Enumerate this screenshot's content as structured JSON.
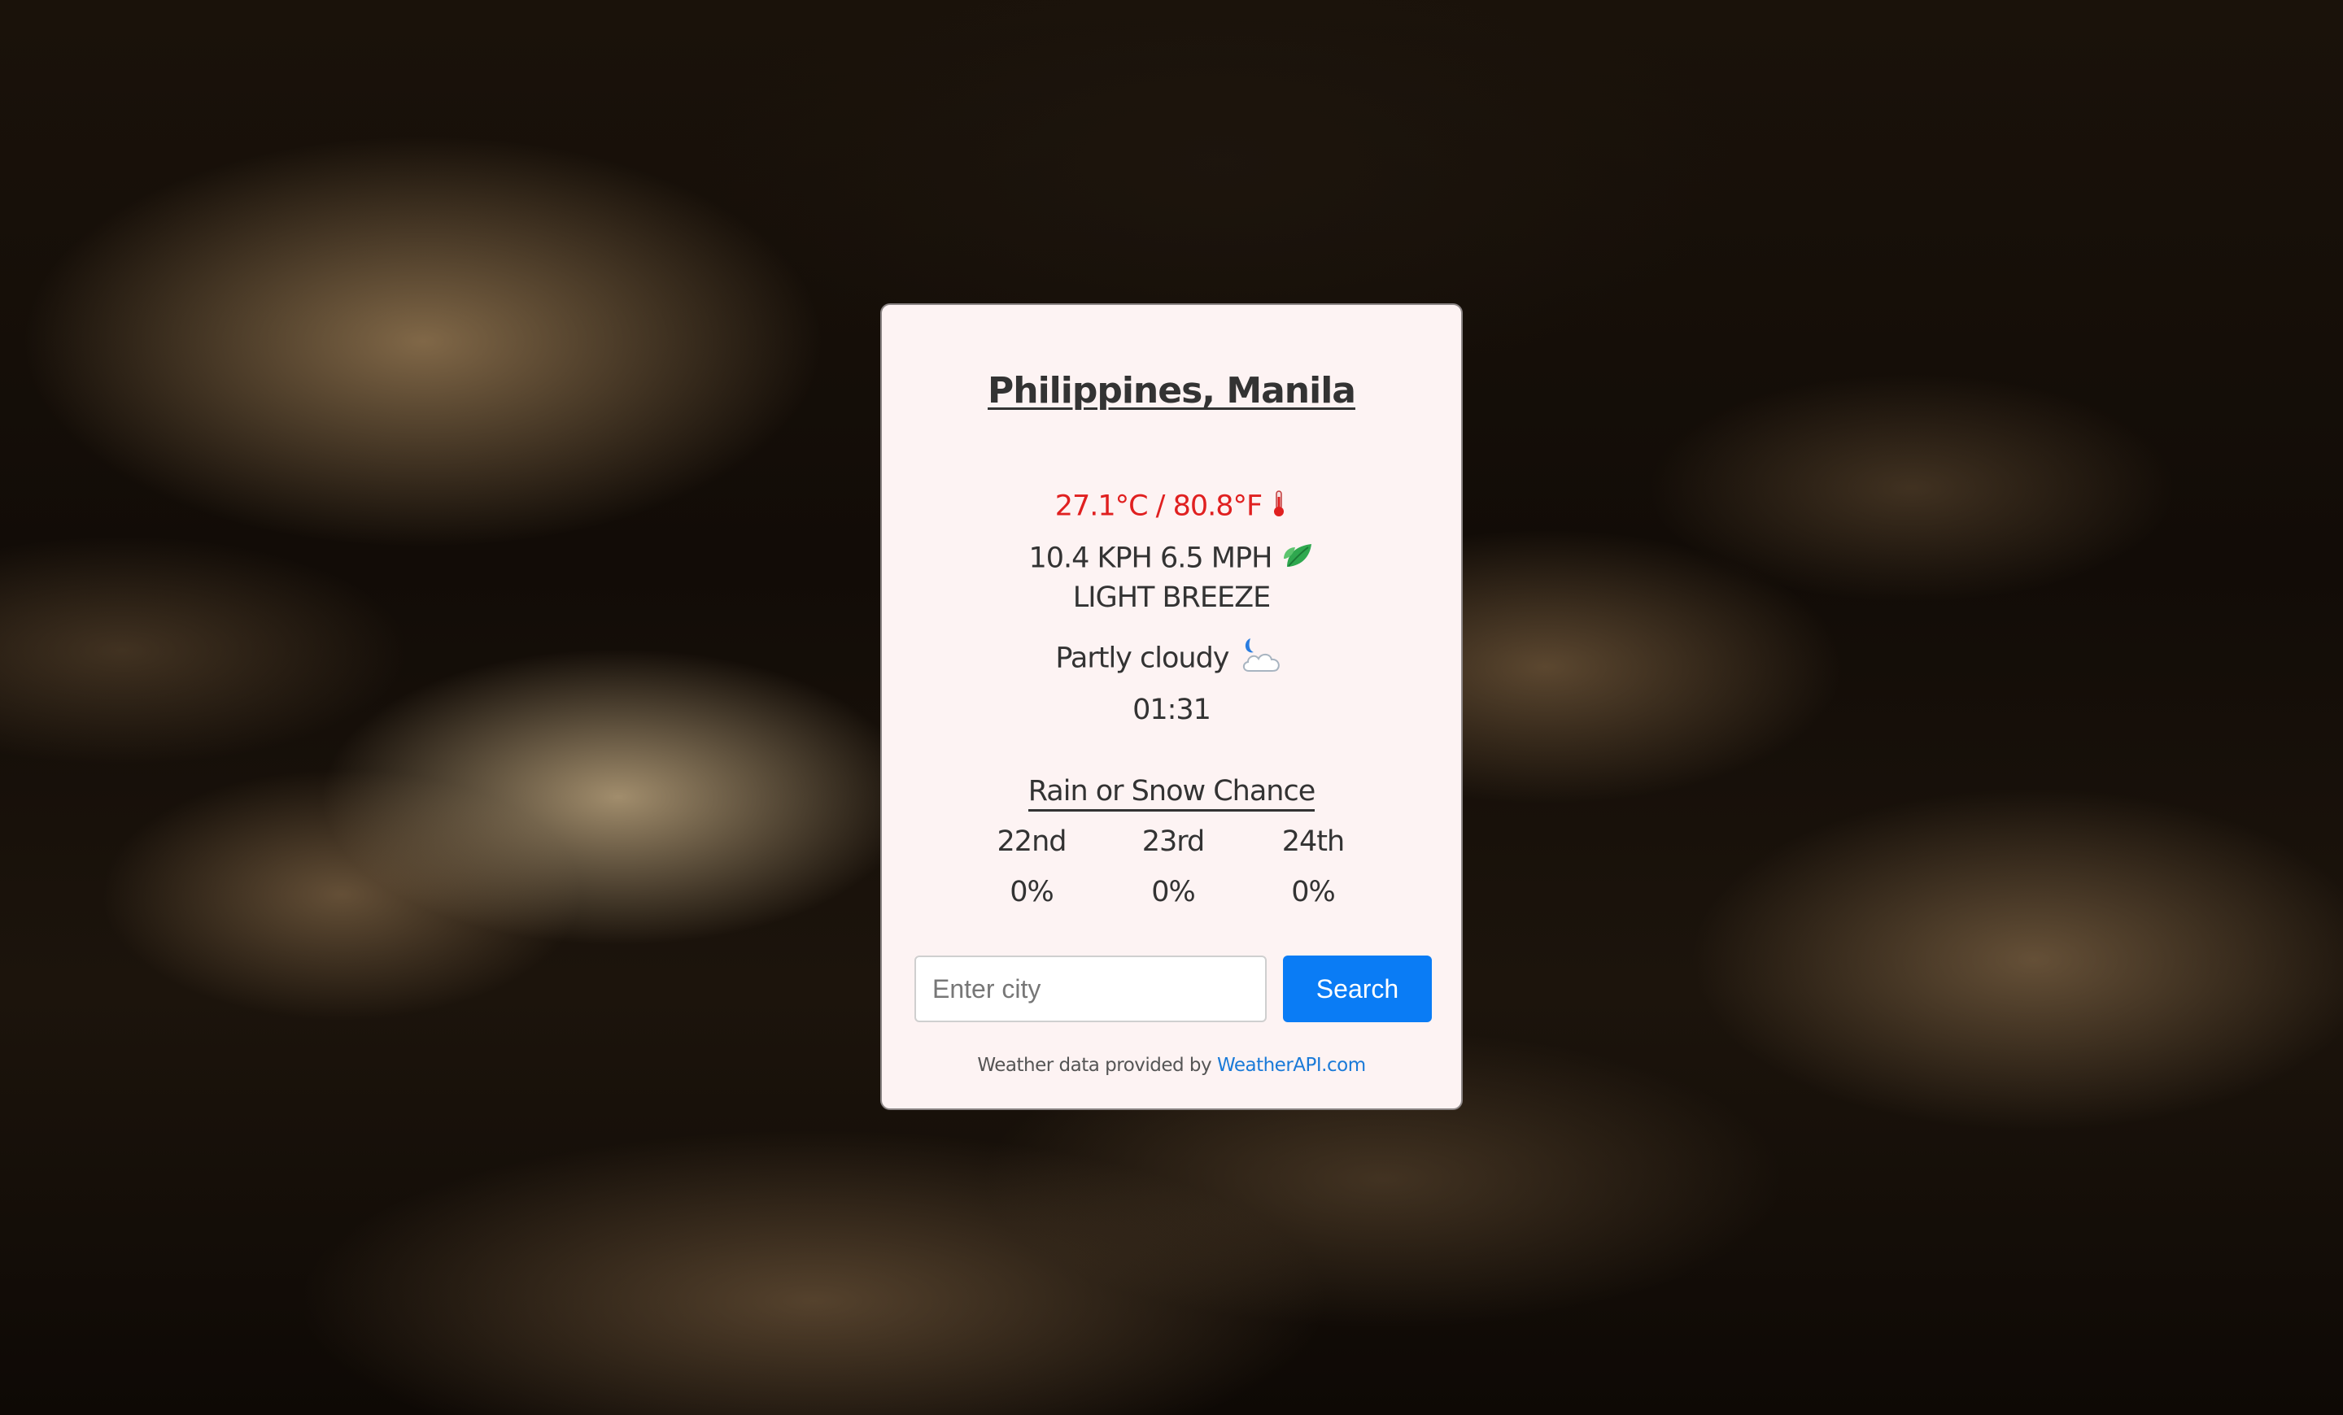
{
  "location": {
    "title": "Philippines, Manila"
  },
  "current": {
    "temperature": "27.1°C / 80.8°F",
    "wind_speed": "10.4 KPH 6.5 MPH",
    "wind_description": "LIGHT BREEZE",
    "condition": "Partly cloudy",
    "local_time": "01:31"
  },
  "forecast": {
    "heading": "Rain or Snow Chance",
    "days": [
      {
        "label": "22nd",
        "chance": "0%"
      },
      {
        "label": "23rd",
        "chance": "0%"
      },
      {
        "label": "24th",
        "chance": "0%"
      }
    ]
  },
  "search": {
    "placeholder": "Enter city",
    "value": "",
    "button_label": "Search"
  },
  "footer": {
    "prefix": "Weather data provided by",
    "link_text": "WeatherAPI.com"
  },
  "icons": {
    "temperature": "thermometer-icon",
    "wind": "leaf-icon",
    "condition": "moon-cloud-icon"
  },
  "colors": {
    "temperature_text": "#e02020",
    "card_background": "#fdf3f3",
    "button_background": "#0a7cf5",
    "link": "#1a7ad8"
  }
}
